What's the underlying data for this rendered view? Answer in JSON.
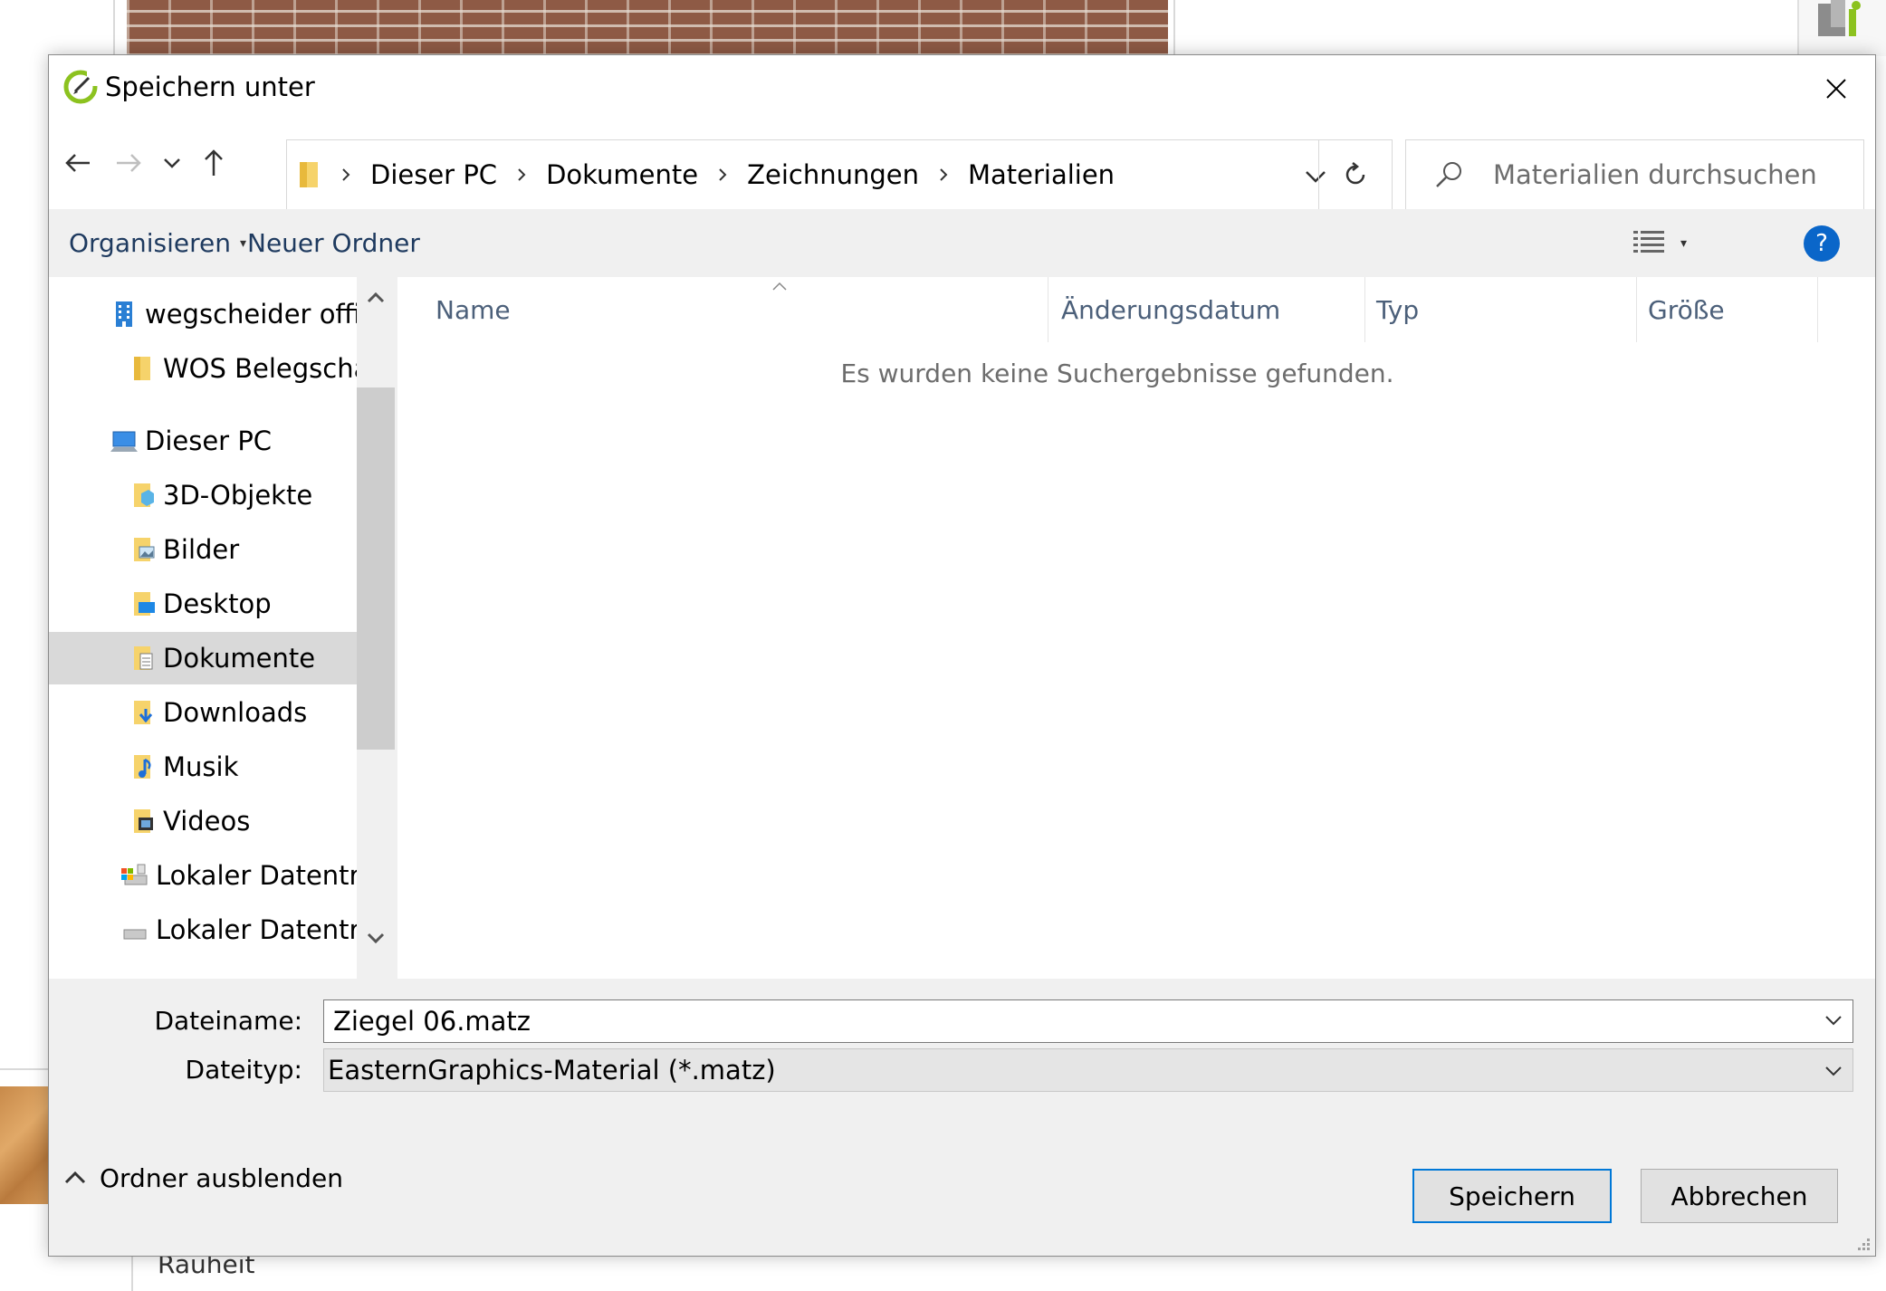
{
  "background": {
    "bottom_label": "Rauheit"
  },
  "dialog": {
    "title": "Speichern unter",
    "navigation": {
      "breadcrumbs": [
        "Dieser PC",
        "Dokumente",
        "Zeichnungen",
        "Materialien"
      ],
      "search_placeholder": "Materialien durchsuchen"
    },
    "toolbar": {
      "organize_label": "Organisieren",
      "new_folder_label": "Neuer Ordner"
    },
    "nav_pane": {
      "items": [
        {
          "label": "wegscheider office",
          "icon": "office-building-icon"
        },
        {
          "label": "WOS Belegschaft",
          "icon": "folder-icon"
        },
        {
          "label": "Dieser PC",
          "icon": "computer-icon"
        },
        {
          "label": "3D-Objekte",
          "icon": "3d-objects-folder-icon"
        },
        {
          "label": "Bilder",
          "icon": "pictures-folder-icon"
        },
        {
          "label": "Desktop",
          "icon": "desktop-folder-icon"
        },
        {
          "label": "Dokumente",
          "icon": "documents-folder-icon",
          "selected": true
        },
        {
          "label": "Downloads",
          "icon": "downloads-folder-icon"
        },
        {
          "label": "Musik",
          "icon": "music-folder-icon"
        },
        {
          "label": "Videos",
          "icon": "videos-folder-icon"
        },
        {
          "label": "Lokaler Datenträger",
          "icon": "local-drive-windows-icon"
        },
        {
          "label": "Lokaler Datenträger",
          "icon": "local-drive-icon"
        }
      ]
    },
    "file_list": {
      "columns": [
        "Name",
        "Änderungsdatum",
        "Typ",
        "Größe"
      ],
      "empty_message": "Es wurden keine Suchergebnisse gefunden."
    },
    "form": {
      "filename_label": "Dateiname:",
      "filename_value": "Ziegel 06.matz",
      "filetype_label": "Dateityp:",
      "filetype_value": "EasternGraphics-Material (*.matz)"
    },
    "hide_folders_label": "Ordner ausblenden",
    "buttons": {
      "save": "Speichern",
      "cancel": "Abbrechen"
    },
    "colors": {
      "accent": "#0078d7",
      "help": "#0a66c9",
      "selection": "#d9d9d9",
      "column_header": "#4c607a"
    }
  }
}
